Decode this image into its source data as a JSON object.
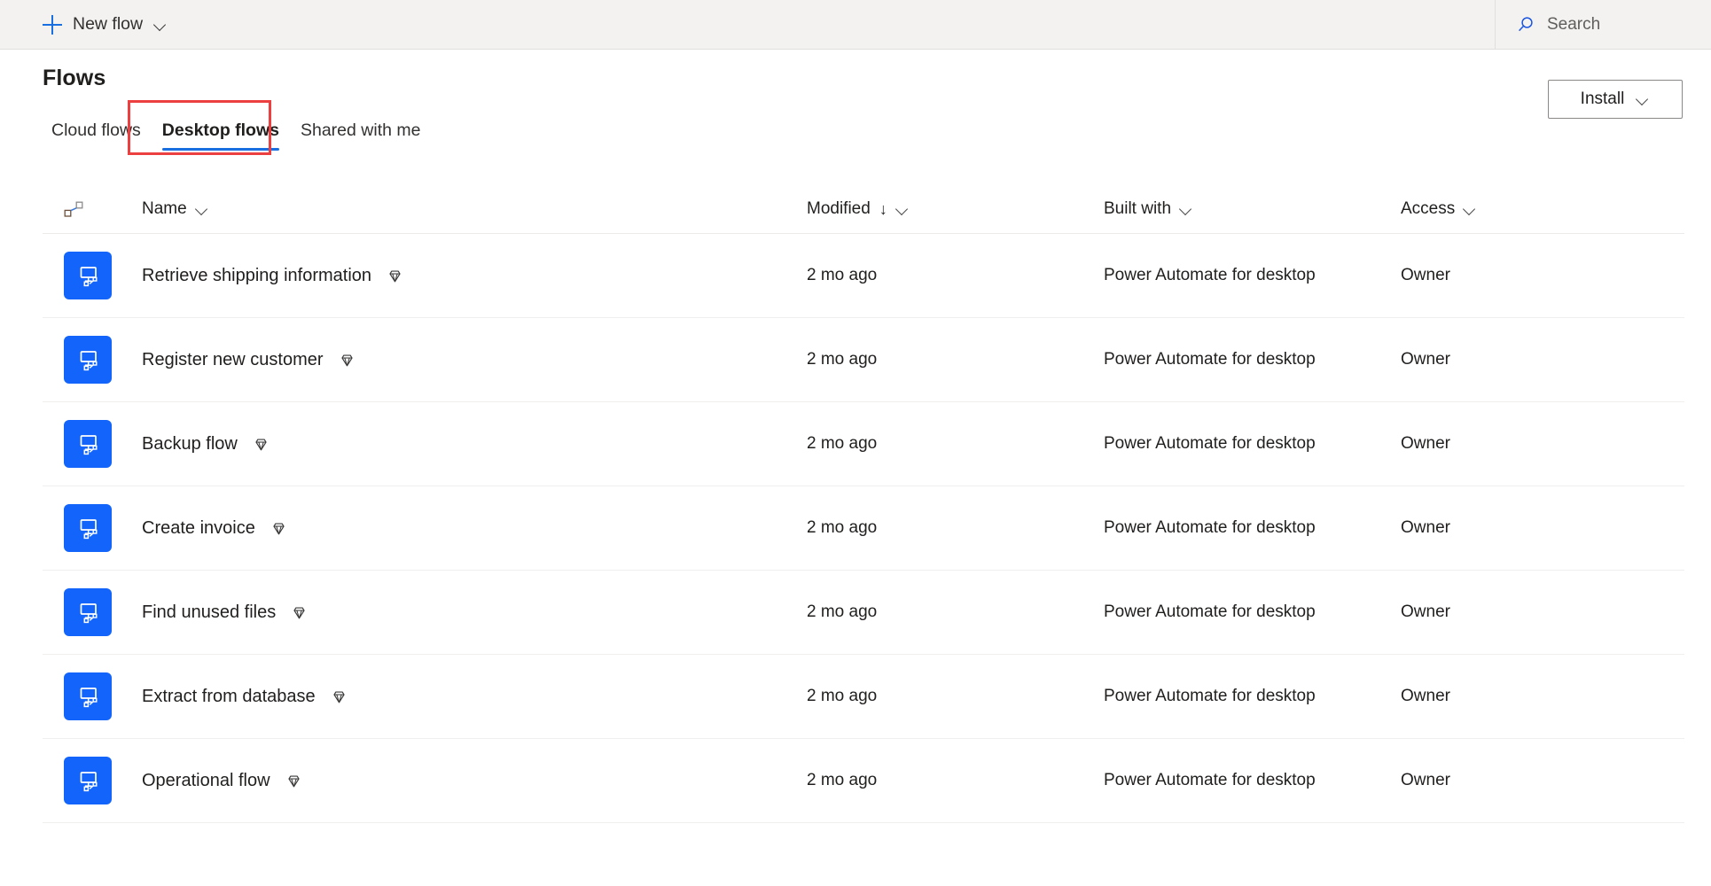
{
  "topbar": {
    "new_flow_label": "New flow",
    "new_flow_icon": "plus-icon",
    "new_flow_chevron": "chevron-down-icon",
    "search_placeholder": "Search",
    "search_icon": "search-icon"
  },
  "header": {
    "title": "Flows",
    "install_label": "Install",
    "install_chevron": "chevron-down-icon"
  },
  "tabs": [
    {
      "label": "Cloud flows",
      "active": false
    },
    {
      "label": "Desktop flows",
      "active": true
    },
    {
      "label": "Shared with me",
      "active": false
    }
  ],
  "annotation": {
    "color": "#ec3f3f",
    "target": "Desktop flows"
  },
  "colors": {
    "accent_blue": "#1a6fe0",
    "tile_blue": "#1264fa",
    "topbar_bg": "#f3f2f1",
    "annotation_red": "#ec3f3f",
    "divider": "#edebe9"
  },
  "table": {
    "columns": [
      {
        "key": "icon",
        "label": "",
        "icon": "flow-connector-icon",
        "sortable": true
      },
      {
        "key": "name",
        "label": "Name",
        "chevron": "chevron-down-icon",
        "sortable": true
      },
      {
        "key": "modified",
        "label": "Modified",
        "sort_indicator": "↓",
        "chevron": "chevron-down-icon",
        "sortable": true
      },
      {
        "key": "built_with",
        "label": "Built with",
        "chevron": "chevron-down-icon",
        "sortable": true
      },
      {
        "key": "access",
        "label": "Access",
        "chevron": "chevron-down-icon",
        "sortable": true
      }
    ],
    "rows": [
      {
        "icon": "desktop-flow-icon",
        "name": "Retrieve shipping information",
        "badge": "premium-gem-icon",
        "modified": "2 mo ago",
        "built_with": "Power Automate for desktop",
        "access": "Owner"
      },
      {
        "icon": "desktop-flow-icon",
        "name": "Register new customer",
        "badge": "premium-gem-icon",
        "modified": "2 mo ago",
        "built_with": "Power Automate for desktop",
        "access": "Owner"
      },
      {
        "icon": "desktop-flow-icon",
        "name": "Backup flow",
        "badge": "premium-gem-icon",
        "modified": "2 mo ago",
        "built_with": "Power Automate for desktop",
        "access": "Owner"
      },
      {
        "icon": "desktop-flow-icon",
        "name": "Create invoice",
        "badge": "premium-gem-icon",
        "modified": "2 mo ago",
        "built_with": "Power Automate for desktop",
        "access": "Owner"
      },
      {
        "icon": "desktop-flow-icon",
        "name": "Find unused files",
        "badge": "premium-gem-icon",
        "modified": "2 mo ago",
        "built_with": "Power Automate for desktop",
        "access": "Owner"
      },
      {
        "icon": "desktop-flow-icon",
        "name": "Extract from database",
        "badge": "premium-gem-icon",
        "modified": "2 mo ago",
        "built_with": "Power Automate for desktop",
        "access": "Owner"
      },
      {
        "icon": "desktop-flow-icon",
        "name": "Operational flow",
        "badge": "premium-gem-icon",
        "modified": "2 mo ago",
        "built_with": "Power Automate for desktop",
        "access": "Owner"
      }
    ]
  }
}
